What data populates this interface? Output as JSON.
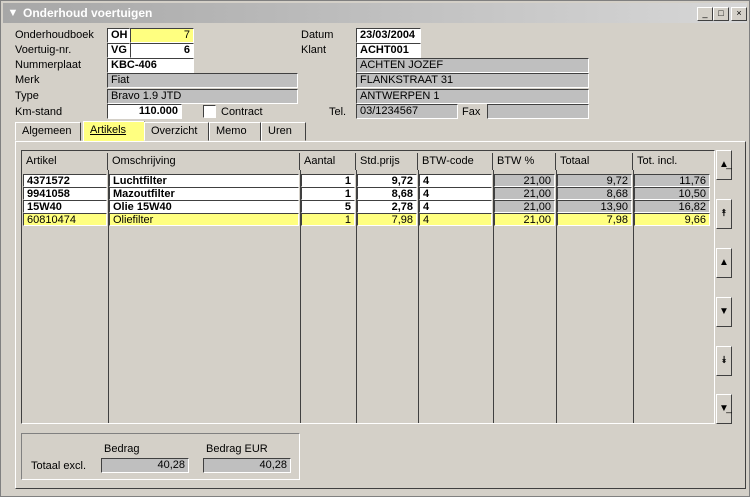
{
  "window": {
    "title": "Onderhoud voertuigen"
  },
  "header": {
    "onderhoudboek_label": "Onderhoudboek",
    "onderhoudboek_code": "OH",
    "onderhoudboek_nr": "7",
    "voertuig_label": "Voertuig-nr.",
    "voertuig_code": "VG",
    "voertuig_nr": "6",
    "nummerplaat_label": "Nummerplaat",
    "nummerplaat": "KBC-406",
    "merk_label": "Merk",
    "merk": "Fiat",
    "type_label": "Type",
    "type": "Bravo 1.9 JTD",
    "km_label": "Km-stand",
    "km": "110.000",
    "contract_label": "Contract",
    "datum_label": "Datum",
    "datum": "23/03/2004",
    "klant_label": "Klant",
    "klant": "ACHT001",
    "klant_naam": "ACHTEN JOZEF",
    "klant_straat": "FLANKSTRAAT 31",
    "klant_gemeente": "ANTWERPEN 1",
    "tel_label": "Tel.",
    "tel": "03/1234567",
    "fax_label": "Fax",
    "fax": ""
  },
  "tabs": [
    {
      "label": "Algemeen"
    },
    {
      "label": "Artikels"
    },
    {
      "label": "Overzicht"
    },
    {
      "label": "Memo"
    },
    {
      "label": "Uren"
    }
  ],
  "grid": {
    "columns": [
      "Artikel",
      "Omschrijving",
      "Aantal",
      "Std.prijs",
      "BTW-code",
      "BTW %",
      "Totaal",
      "Tot. incl."
    ],
    "rows": [
      {
        "artikel": "4371572",
        "omschrijving": "Luchtfilter",
        "aantal": "1",
        "prijs": "9,72",
        "btwcode": "4",
        "btwpct": "21,00",
        "totaal": "9,72",
        "incl": "11,76"
      },
      {
        "artikel": "9941058",
        "omschrijving": "Mazoutfilter",
        "aantal": "1",
        "prijs": "8,68",
        "btwcode": "4",
        "btwpct": "21,00",
        "totaal": "8,68",
        "incl": "10,50"
      },
      {
        "artikel": "15W40",
        "omschrijving": "Olie 15W40",
        "aantal": "5",
        "prijs": "2,78",
        "btwcode": "4",
        "btwpct": "21,00",
        "totaal": "13,90",
        "incl": "16,82"
      },
      {
        "artikel": "60810474",
        "omschrijving": "Oliefilter",
        "aantal": "1",
        "prijs": "7,98",
        "btwcode": "4",
        "btwpct": "21,00",
        "totaal": "7,98",
        "incl": "9,66"
      }
    ]
  },
  "totals": {
    "bedrag_label": "Bedrag",
    "bedrag_eur_label": "Bedrag EUR",
    "totaal_excl_label": "Totaal excl.",
    "bedrag": "40,28",
    "bedrag_eur": "40,28"
  },
  "colors": {
    "highlight": "#ffff80",
    "readonly": "#bfbfbf",
    "window_bg": "#d4d0c8"
  }
}
